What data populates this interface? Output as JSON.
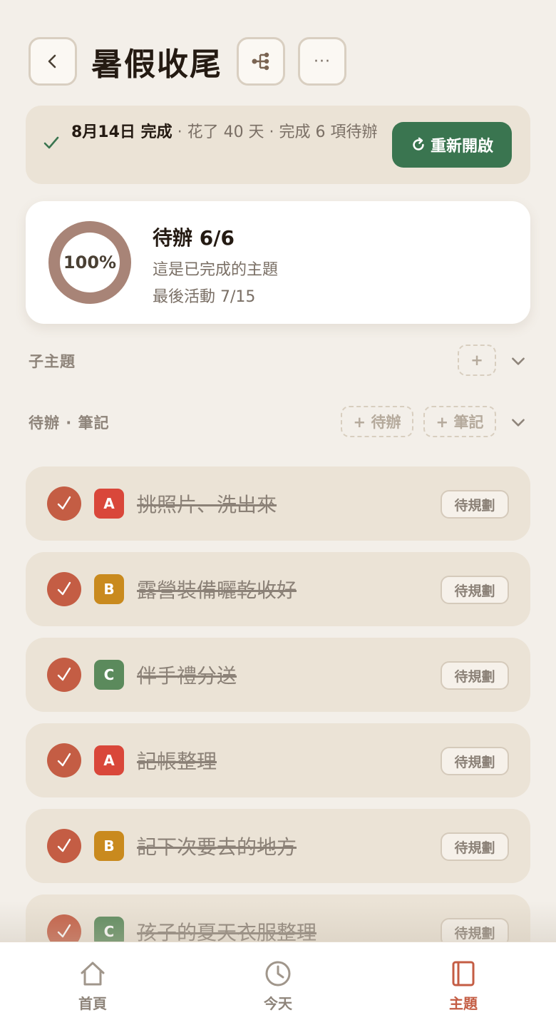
{
  "header": {
    "title": "暑假收尾",
    "back_icon": "chevron-left-icon",
    "tree_icon": "hierarchy-icon",
    "more_label": "···"
  },
  "banner": {
    "date_done": "8月14日 完成",
    "details": " · 花了 40 天 · 完成 6 項待辦",
    "reopen_label": "重新開啟",
    "accent": "#3a7550"
  },
  "summary": {
    "percent": "100%",
    "progress": 1.0,
    "title": "待辦 6/6",
    "subtitle": "這是已完成的主題",
    "last_activity": "最後活動 7/15",
    "ring_color": "#a88477"
  },
  "sections": {
    "subtopics": {
      "label": "子主題",
      "add_label": "+"
    },
    "todos": {
      "label": "待辦 · 筆記",
      "add_todo_label": "+ 待辦",
      "add_note_label": "+ 筆記"
    }
  },
  "tasks": [
    {
      "priority": "A",
      "title": "挑照片、洗出來",
      "tag": "待規劃"
    },
    {
      "priority": "B",
      "title": "露營裝備曬乾收好",
      "tag": "待規劃"
    },
    {
      "priority": "C",
      "title": "伴手禮分送",
      "tag": "待規劃"
    },
    {
      "priority": "A",
      "title": "記帳整理",
      "tag": "待規劃"
    },
    {
      "priority": "B",
      "title": "記下次要去的地方",
      "tag": "待規劃"
    },
    {
      "priority": "C",
      "title": "孩子的夏天衣服整理",
      "tag": "待規劃"
    }
  ],
  "priority_colors": {
    "A": "#d9473a",
    "B": "#c98a1e",
    "C": "#5b8a5c"
  },
  "nav": {
    "items": [
      {
        "label": "首頁",
        "icon": "home-icon"
      },
      {
        "label": "今天",
        "icon": "clock-icon"
      },
      {
        "label": "主題",
        "icon": "book-icon"
      }
    ],
    "active": "主題",
    "active_color": "#c45d44"
  }
}
